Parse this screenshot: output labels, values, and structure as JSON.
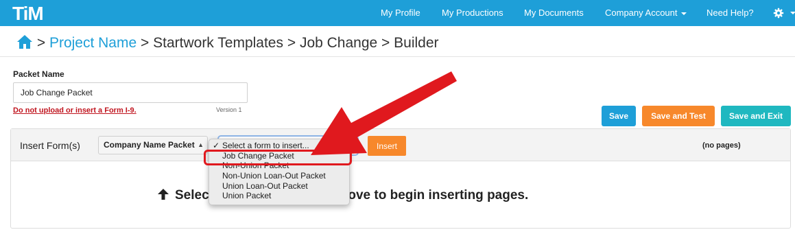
{
  "nav": {
    "logo": "TiM",
    "links": [
      "My Profile",
      "My Productions",
      "My Documents",
      "Company Account",
      "Need Help?"
    ]
  },
  "breadcrumb": {
    "separator": ">",
    "project": "Project Name",
    "crumbs": [
      "Startwork Templates",
      "Job Change",
      "Builder"
    ]
  },
  "packet": {
    "label": "Packet Name",
    "value": "Job Change Packet",
    "warning": "Do not upload or insert a Form I-9.",
    "version": "Version 1"
  },
  "actions": {
    "save": "Save",
    "save_test": "Save and Test",
    "save_exit": "Save and Exit"
  },
  "insert_panel": {
    "label": "Insert Form(s)",
    "company_select": "Company Name  Packet",
    "insert_button": "Insert",
    "pages_status": "(no pages)",
    "hint": "Select a packet or a form above to begin inserting pages."
  },
  "dropdown": {
    "selected_check": "✓",
    "options": [
      "Select a form to insert...",
      "Job Change Packet",
      "Non-Union Packet",
      "Non-Union Loan-Out Packet",
      "Union Loan-Out Packet",
      "Union Packet"
    ]
  },
  "colors": {
    "brand": "#1e9fd8",
    "orange": "#f7882b",
    "teal": "#1fb8c0",
    "annotation_red": "#e0191e"
  },
  "icons": {
    "home": "home-icon",
    "gear": "gear-icon",
    "arrow_up": "arrow-up-icon",
    "callout": "callout-arrow-icon"
  }
}
